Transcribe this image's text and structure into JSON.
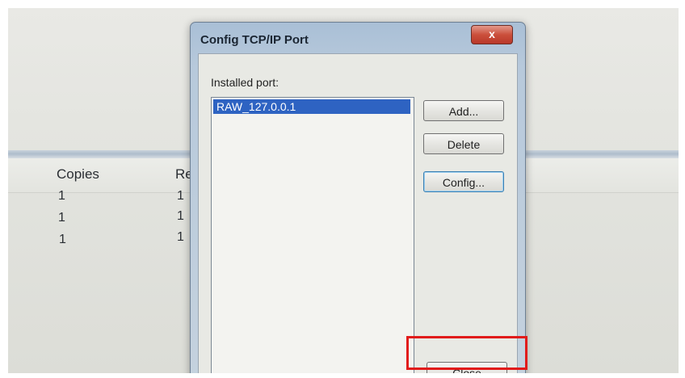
{
  "background_app": {
    "columns": [
      "Copies",
      "Re"
    ],
    "rows": [
      [
        "1",
        "1"
      ],
      [
        "1",
        "1"
      ],
      [
        "1",
        "1"
      ]
    ]
  },
  "dialog": {
    "title": "Config TCP/IP Port",
    "close_glyph": "x",
    "installed_port_label": "Installed port:",
    "ports": [
      "RAW_127.0.0.1"
    ],
    "buttons": {
      "add": "Add...",
      "delete": "Delete",
      "config": "Config...",
      "close": "Close"
    }
  },
  "annotation": {
    "highlight_color": "#e11b1b"
  }
}
